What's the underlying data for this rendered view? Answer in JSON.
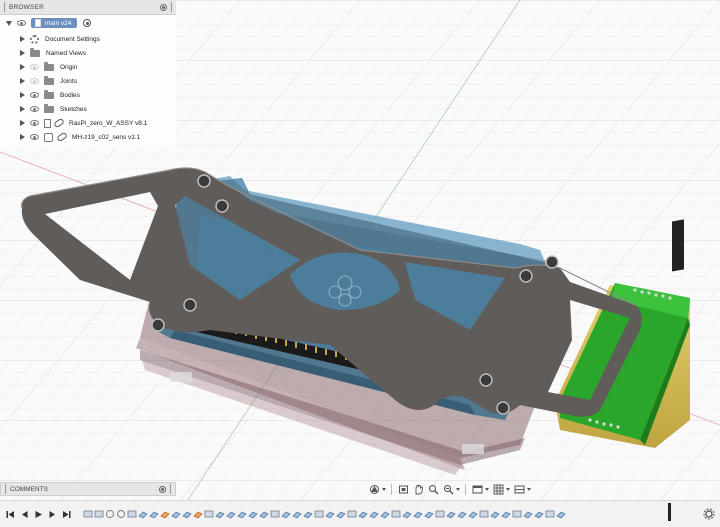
{
  "browser": {
    "title": "BROWSER",
    "root_label": "main v24",
    "items": [
      {
        "label": "Document Settings",
        "icon": "gear-icon"
      },
      {
        "label": "Named Views",
        "icon": "folder-icon"
      },
      {
        "label": "Origin",
        "icon": "folder-icon"
      },
      {
        "label": "Joints",
        "icon": "folder-icon"
      },
      {
        "label": "Bodies",
        "icon": "folder-icon"
      },
      {
        "label": "Sketches",
        "icon": "folder-icon"
      },
      {
        "label": "RasPi_zero_W_ASSY v8:1",
        "icon": "component-link-icon"
      },
      {
        "label": "MH-z19_c02_sens v1:1",
        "icon": "component-link-icon"
      }
    ]
  },
  "comments": {
    "title": "COMMENTS"
  },
  "colors": {
    "active_item": "#6d8fbf",
    "pcb_green": "#2aa62a",
    "enclosure_blue": "#4d7f9c",
    "plate_gray": "#6f6c69",
    "axis_red": "#e05a5a",
    "axis_green": "#7ab87a"
  },
  "nav_toolbar": [
    "orbit-icon",
    "look-at-icon",
    "pan-icon",
    "zoom-icon",
    "fit-icon",
    "display-settings-icon",
    "grid-icon",
    "viewports-icon"
  ],
  "timeline_controls": [
    "first-step-icon",
    "previous-step-icon",
    "play-icon",
    "next-step-icon",
    "last-step-icon"
  ]
}
